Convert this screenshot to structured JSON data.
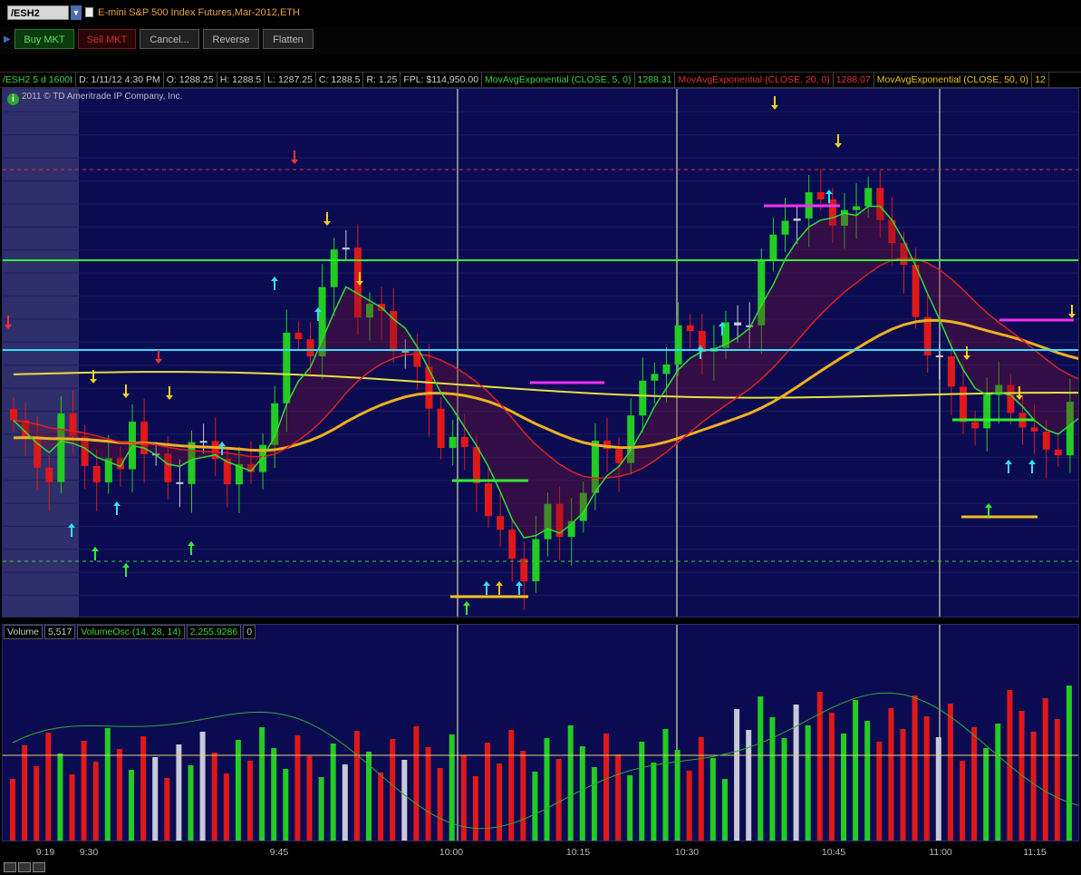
{
  "window": {
    "symbol": "/ESH2",
    "title": "E-mini S&P 500 Index Futures,Mar-2012,ETH"
  },
  "trade_bar": {
    "buy": "Buy MKT",
    "sell": "Sell MKT",
    "cancel": "Cancel...",
    "reverse": "Reverse",
    "flatten": "Flatten"
  },
  "info_bar": [
    {
      "text": "/ESH2 5 d 1600t",
      "color": "#3fd43f"
    },
    {
      "text": "D: 1/11/12 4:30 PM",
      "color": "#cccccc"
    },
    {
      "text": "O: 1288.25",
      "color": "#cccccc"
    },
    {
      "text": "H: 1288.5",
      "color": "#cccccc"
    },
    {
      "text": "L: 1287.25",
      "color": "#cccccc"
    },
    {
      "text": "C: 1288.5",
      "color": "#cccccc"
    },
    {
      "text": "R: 1.25",
      "color": "#cccccc"
    },
    {
      "text": "FPL: $114,950.00",
      "color": "#cccccc"
    },
    {
      "text": "MovAvgExponential (CLOSE, 5, 0)",
      "color": "#3fd43f"
    },
    {
      "text": "1288.31",
      "color": "#3fd43f"
    },
    {
      "text": "MovAvgExponential (CLOSE, 20, 0)",
      "color": "#e03030"
    },
    {
      "text": "1288.07",
      "color": "#e03030"
    },
    {
      "text": "MovAvgExponential (CLOSE, 50, 0)",
      "color": "#f0c020"
    },
    {
      "text": "12",
      "color": "#f0c020"
    }
  ],
  "copyright": "2011 © TD Ameritrade IP Company, Inc.",
  "volume_header": {
    "label": "Volume",
    "value": "5,517",
    "osc_label": "VolumeOsc (14, 28, 14)",
    "osc_value": "2,255.9286",
    "zero": "0"
  },
  "time_axis": [
    "9:19",
    "9:30",
    "9:45",
    "10:00",
    "10:15",
    "10:30",
    "10:45",
    "11:00",
    "11:15"
  ],
  "colors": {
    "bull": "#22cc22",
    "bear": "#e01818",
    "neutral": "#c8c8d8",
    "ema5": "#33dd33",
    "ema20": "#dd2020",
    "ema50": "#f0b020",
    "sma_long": "#e8e040",
    "level_green": "#33ee33",
    "level_cyan": "#33e0ff",
    "background": "#0b0b52"
  },
  "chart_data": {
    "type": "candlestick",
    "ema5": [
      1284.6,
      1284.1,
      1283.6,
      1283.2,
      1283.7,
      1283.6,
      1283.4,
      1283.0,
      1282.8,
      1282.6,
      1283.5,
      1283.4,
      1283.1,
      1282.7,
      1282.6,
      1282.9,
      1283.0,
      1283.1,
      1282.8,
      1282.6,
      1282.4,
      1283.0,
      1283.9,
      1285.3,
      1286.3,
      1286.9,
      1288.1,
      1289.3,
      1290.4,
      1290.1,
      1289.8,
      1289.5,
      1289.0,
      1288.6,
      1287.8,
      1286.8,
      1285.8,
      1285.1,
      1284.3,
      1283.5,
      1282.6,
      1281.5,
      1280.3,
      1279.5,
      1279.6,
      1279.9,
      1279.7,
      1280.1,
      1280.6,
      1281.5,
      1282.2,
      1282.6,
      1283.3,
      1284.2,
      1285.2,
      1286.0,
      1286.8,
      1287.3,
      1287.6,
      1287.7,
      1287.9,
      1288.2,
      1288.6,
      1289.6,
      1290.5,
      1291.6,
      1292.4,
      1293.0,
      1293.3,
      1293.4,
      1293.6,
      1293.5,
      1293.9,
      1293.9,
      1293.3,
      1292.4,
      1291.3,
      1290.1,
      1289.0,
      1287.8,
      1286.8,
      1286.0,
      1285.7,
      1285.8,
      1285.7,
      1285.2,
      1284.6,
      1284.2,
      1284.0,
      1284.4,
      1284.8,
      1285.5
    ]
  }
}
